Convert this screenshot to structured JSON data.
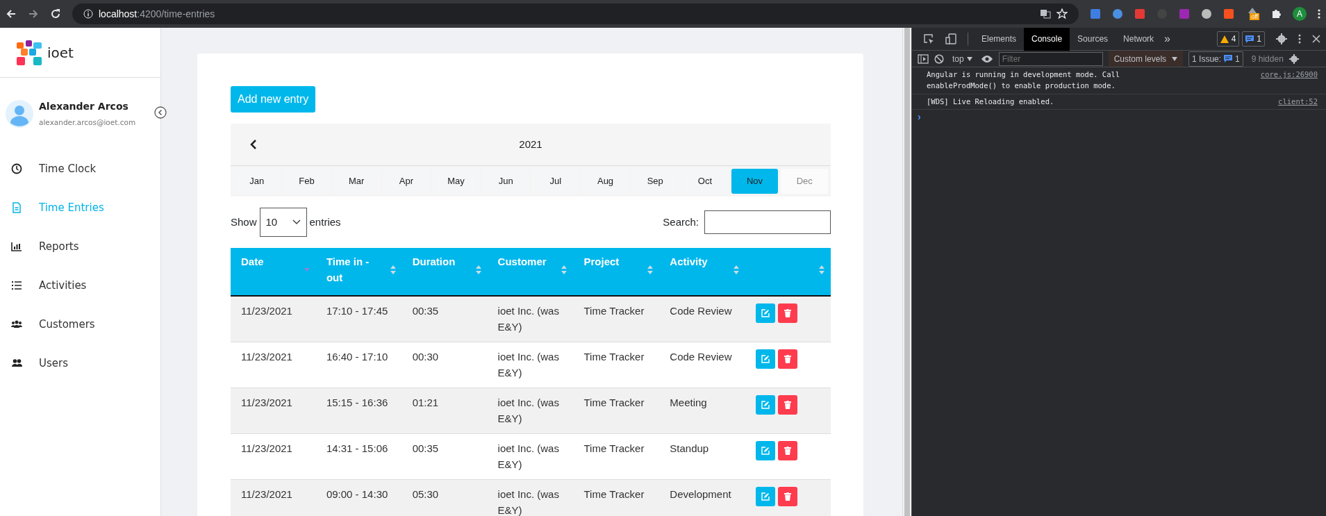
{
  "browser": {
    "url_host": "localhost",
    "url_path": ":4200/time-entries",
    "extension_badge": "off",
    "profile_initial": "A"
  },
  "sidebar": {
    "logo_text": "ioet",
    "user": {
      "name": "Alexander Arcos",
      "email": "alexander.arcos@ioet.com"
    },
    "items": [
      {
        "label": "Time Clock",
        "kind": "clock",
        "selected": false
      },
      {
        "label": "Time Entries",
        "kind": "document",
        "selected": true
      },
      {
        "label": "Reports",
        "kind": "chart",
        "selected": false
      },
      {
        "label": "Activities",
        "kind": "list",
        "selected": false
      },
      {
        "label": "Customers",
        "kind": "group",
        "selected": false
      },
      {
        "label": "Users",
        "kind": "users",
        "selected": false
      }
    ]
  },
  "main": {
    "add_button": "Add new entry",
    "calendar": {
      "year": "2021",
      "months": [
        {
          "label": "Jan",
          "selected": false,
          "disabled": false
        },
        {
          "label": "Feb",
          "selected": false,
          "disabled": false
        },
        {
          "label": "Mar",
          "selected": false,
          "disabled": false
        },
        {
          "label": "Apr",
          "selected": false,
          "disabled": false
        },
        {
          "label": "May",
          "selected": false,
          "disabled": false
        },
        {
          "label": "Jun",
          "selected": false,
          "disabled": false
        },
        {
          "label": "Jul",
          "selected": false,
          "disabled": false
        },
        {
          "label": "Aug",
          "selected": false,
          "disabled": false
        },
        {
          "label": "Sep",
          "selected": false,
          "disabled": false
        },
        {
          "label": "Oct",
          "selected": false,
          "disabled": false
        },
        {
          "label": "Nov",
          "selected": true,
          "disabled": false
        },
        {
          "label": "Dec",
          "selected": false,
          "disabled": true
        }
      ]
    },
    "show_label": "Show",
    "page_size": "10",
    "entries_label": "entries",
    "search_label": "Search:",
    "table": {
      "columns": [
        {
          "label": "Date",
          "sorted": true
        },
        {
          "label": "Time in - out",
          "sorted": false
        },
        {
          "label": "Duration",
          "sorted": false
        },
        {
          "label": "Customer",
          "sorted": false
        },
        {
          "label": "Project",
          "sorted": false
        },
        {
          "label": "Activity",
          "sorted": false
        },
        {
          "sorted": false
        }
      ],
      "rows": [
        [
          "11/23/2021",
          "17:10 - 17:45",
          "00:35",
          "ioet Inc. (was E&Y)",
          "Time Tracker",
          "Code Review"
        ],
        [
          "11/23/2021",
          "16:40 - 17:10",
          "00:30",
          "ioet Inc. (was E&Y)",
          "Time Tracker",
          "Code Review"
        ],
        [
          "11/23/2021",
          "15:15 - 16:36",
          "01:21",
          "ioet Inc. (was E&Y)",
          "Time Tracker",
          "Meeting"
        ],
        [
          "11/23/2021",
          "14:31 - 15:06",
          "00:35",
          "ioet Inc. (was E&Y)",
          "Time Tracker",
          "Standup"
        ],
        [
          "11/23/2021",
          "09:00 - 14:30",
          "05:30",
          "ioet Inc. (was E&Y)",
          "Time Tracker",
          "Development"
        ]
      ]
    }
  },
  "devtools": {
    "tabs": [
      {
        "label": "Elements",
        "selected": false
      },
      {
        "label": "Console",
        "selected": true
      },
      {
        "label": "Sources",
        "selected": false
      },
      {
        "label": "Network",
        "selected": false
      }
    ],
    "more": "»",
    "warnings": "4",
    "messages_count": "1",
    "context": "top",
    "filter_placeholder": "Filter",
    "levels": "Custom levels",
    "issues_label": "1 Issue:",
    "issues_count": "1",
    "hidden": "9 hidden",
    "messages": [
      {
        "text": "Angular is running in development mode. Call enableProdMode() to enable production mode.",
        "source": "core.js:26900"
      },
      {
        "text": "[WDS] Live Reloading enabled.",
        "source": "client:52"
      }
    ],
    "prompt": "›"
  }
}
